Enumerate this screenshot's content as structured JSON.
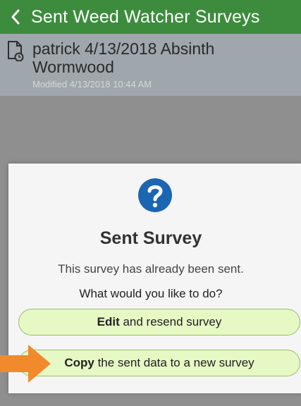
{
  "header": {
    "title": "Sent Weed Watcher Surveys",
    "back_icon": "chevron-left-icon",
    "color": "#3d8c3d"
  },
  "survey_item": {
    "title": "patrick 4/13/2018 Absinth Wormwood",
    "modified": "Modified 4/13/2018 10:44 AM",
    "icon": "document-clock-icon"
  },
  "dialog": {
    "icon": "question-icon",
    "title": "Sent Survey",
    "message": "This survey has already been sent.",
    "question": "What would you like to do?",
    "edit_option": {
      "bold": "Edit",
      "rest": " and resend survey"
    },
    "copy_option": {
      "bold": "Copy",
      "rest": " the sent data to a new survey"
    },
    "button_color": "#e6f8c4"
  },
  "annotation": {
    "icon": "orange-arrow-icon",
    "color": "#f08a2c"
  }
}
